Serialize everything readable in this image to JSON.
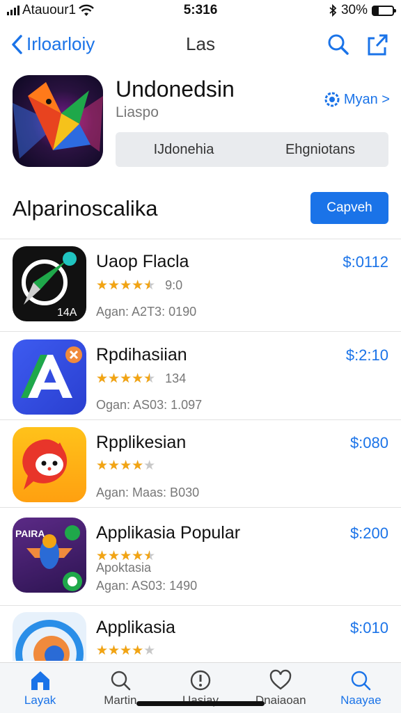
{
  "status": {
    "carrier": "Atauour1",
    "time": "5:316",
    "battery": "30%",
    "battery_level": 0.3
  },
  "nav": {
    "back_label": "Irloarloiy",
    "title": "Las"
  },
  "featured": {
    "name": "Undonedsin",
    "subtitle": "Liaspo",
    "link_label": "Myan >",
    "segments": [
      "IJdonehia",
      "Ehgniotans"
    ]
  },
  "section": {
    "title": "Alparinoscalika",
    "button_label": "Capveh"
  },
  "apps": [
    {
      "name": "Uaop Flacla",
      "price": "$:0112",
      "rating": 4.5,
      "rating_count": "9:0",
      "meta": "Agan: A2T3: 0190",
      "icon_badge": "14A"
    },
    {
      "name": "Rpdihasiian",
      "price": "$:2:10",
      "rating": 4.5,
      "rating_count": "134",
      "meta": "Ogan: AS03: 1.097"
    },
    {
      "name": "Rpplikesian",
      "price": "$:080",
      "rating": 4,
      "rating_count": "",
      "meta": "Agan: Maas: B030"
    },
    {
      "name": "Applikasia Popular",
      "price": "$:200",
      "rating": 4.5,
      "rating_count": "",
      "meta_top": "Apoktasia",
      "meta": "Agan: AS03: 1490",
      "icon_badge": "PAIRA"
    },
    {
      "name": "Applikasia",
      "price": "$:010",
      "rating": 4,
      "rating_count": "",
      "meta": ""
    }
  ],
  "tabs": [
    {
      "label": "Layak",
      "icon": "home-icon",
      "active": true
    },
    {
      "label": "Martin",
      "icon": "search-icon",
      "active": false
    },
    {
      "label": "Uasiay",
      "icon": "alert-icon",
      "active": false
    },
    {
      "label": "Dnaiaoan",
      "icon": "heart-icon",
      "active": false
    },
    {
      "label": "Naayae",
      "icon": "search-icon",
      "active": true
    }
  ],
  "colors": {
    "accent": "#1a73e8",
    "star": "#f2a413",
    "background": "#ffffff"
  }
}
